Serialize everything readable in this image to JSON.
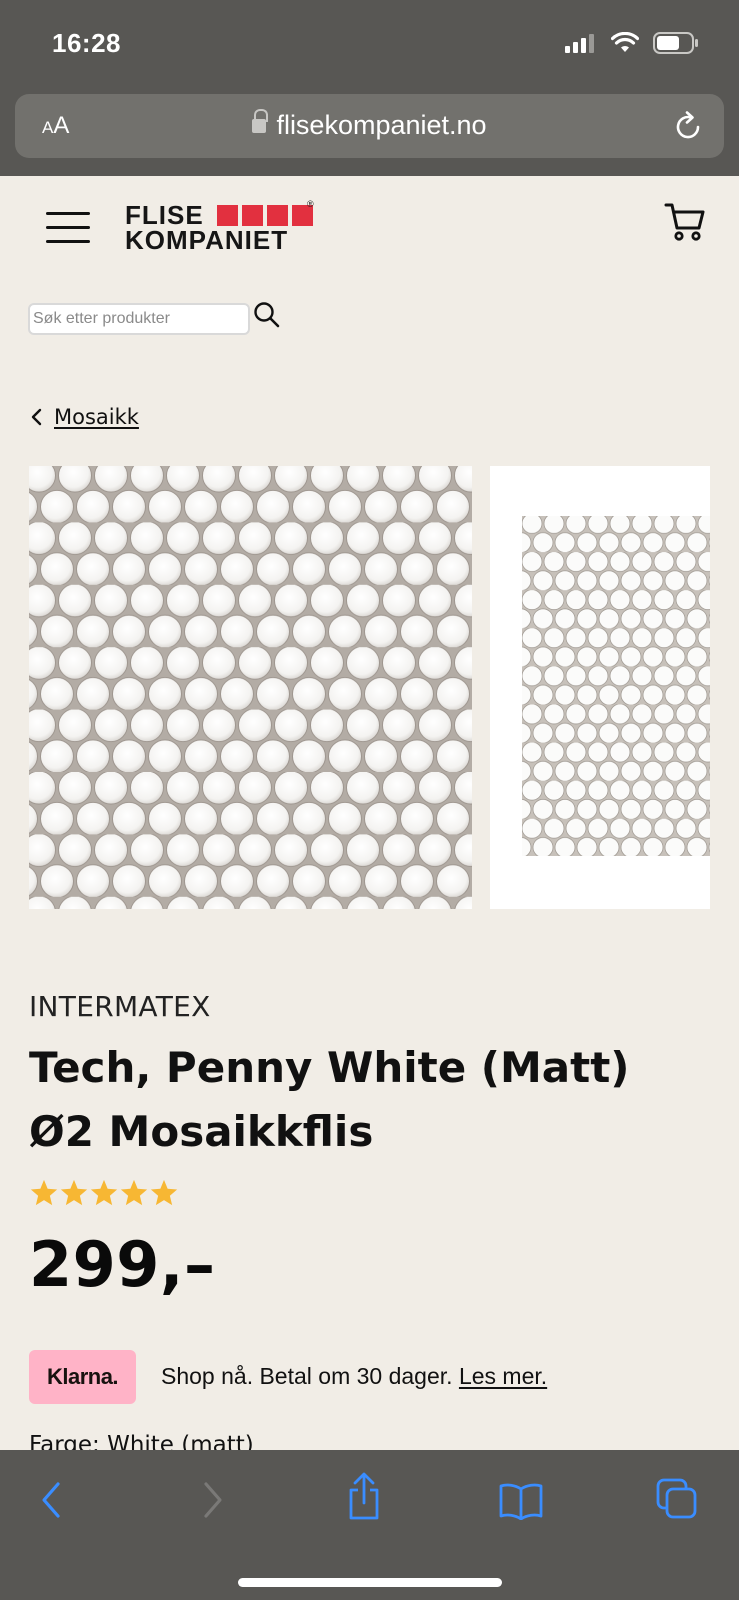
{
  "status": {
    "time": "16:28"
  },
  "browser": {
    "aa_small": "A",
    "aa_large": "A",
    "url": "flisekompaniet.no"
  },
  "header": {
    "logo_line1": "FLISE",
    "logo_line2": "KOMPANIET",
    "logo_reg": "®",
    "brand_color": "#e2303f"
  },
  "search": {
    "placeholder": "Søk etter produkter",
    "value": ""
  },
  "breadcrumb": {
    "label": "Mosaikk"
  },
  "product": {
    "brand": "INTERMATEX",
    "title": "Tech, Penny White (Matt) Ø2 Mosaikkflis",
    "rating": 5,
    "rating_max": 5,
    "star_color": "#f7b733",
    "price": "299,–",
    "klarna_logo": "Klarna.",
    "klarna_text": "Shop nå. Betal om 30 dager.",
    "klarna_link": "Les mer.",
    "farge": "Farge: White (matt)"
  },
  "icons": {
    "menu": "hamburger-icon",
    "cart": "cart-icon",
    "search": "search-icon",
    "back": "chevron-left-icon",
    "reload": "reload-icon",
    "lock": "lock-icon",
    "nav_back": "back-arrow-icon",
    "nav_forward": "forward-arrow-icon",
    "share": "share-icon",
    "bookmarks": "bookmarks-icon",
    "tabs": "tabs-icon"
  }
}
